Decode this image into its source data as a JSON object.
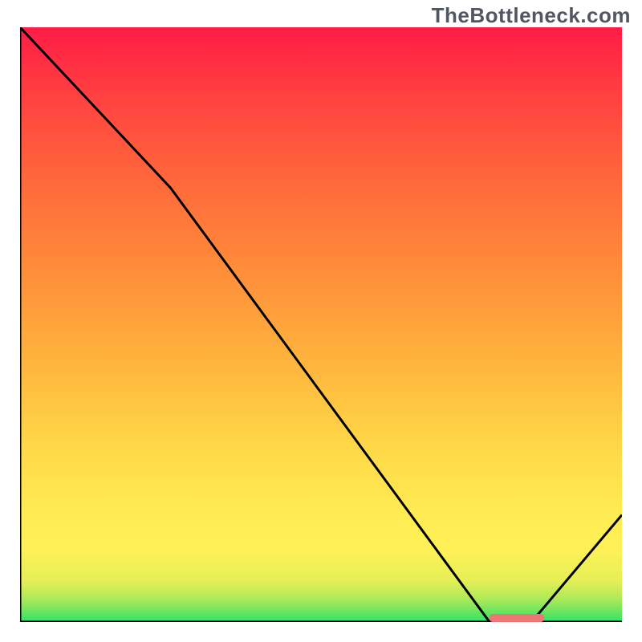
{
  "branding": {
    "watermark": "TheBottleneck.com"
  },
  "chart_data": {
    "type": "line",
    "title": "",
    "xlabel": "",
    "ylabel": "",
    "xlim": [
      0,
      100
    ],
    "ylim": [
      0,
      100
    ],
    "grid": false,
    "legend": false,
    "series": [
      {
        "name": "curve",
        "x": [
          0,
          25,
          78,
          85,
          100
        ],
        "y": [
          100,
          73,
          0,
          0,
          18
        ]
      }
    ],
    "optimal_band_x": [
      78,
      87
    ],
    "gradient_stops": [
      {
        "offset": 0.0,
        "color": "#2fe26a"
      },
      {
        "offset": 0.02,
        "color": "#73e65e"
      },
      {
        "offset": 0.04,
        "color": "#b0ea58"
      },
      {
        "offset": 0.07,
        "color": "#e6ef57"
      },
      {
        "offset": 0.12,
        "color": "#fef157"
      },
      {
        "offset": 0.18,
        "color": "#ffec52"
      },
      {
        "offset": 0.3,
        "color": "#ffd747"
      },
      {
        "offset": 0.45,
        "color": "#ffb13c"
      },
      {
        "offset": 0.6,
        "color": "#ff8b39"
      },
      {
        "offset": 0.75,
        "color": "#ff663b"
      },
      {
        "offset": 0.88,
        "color": "#ff4240"
      },
      {
        "offset": 1.0,
        "color": "#ff1c46"
      }
    ]
  },
  "colors": {
    "curve": "#000000",
    "axes": "#000000",
    "marker": "#ed7774"
  }
}
